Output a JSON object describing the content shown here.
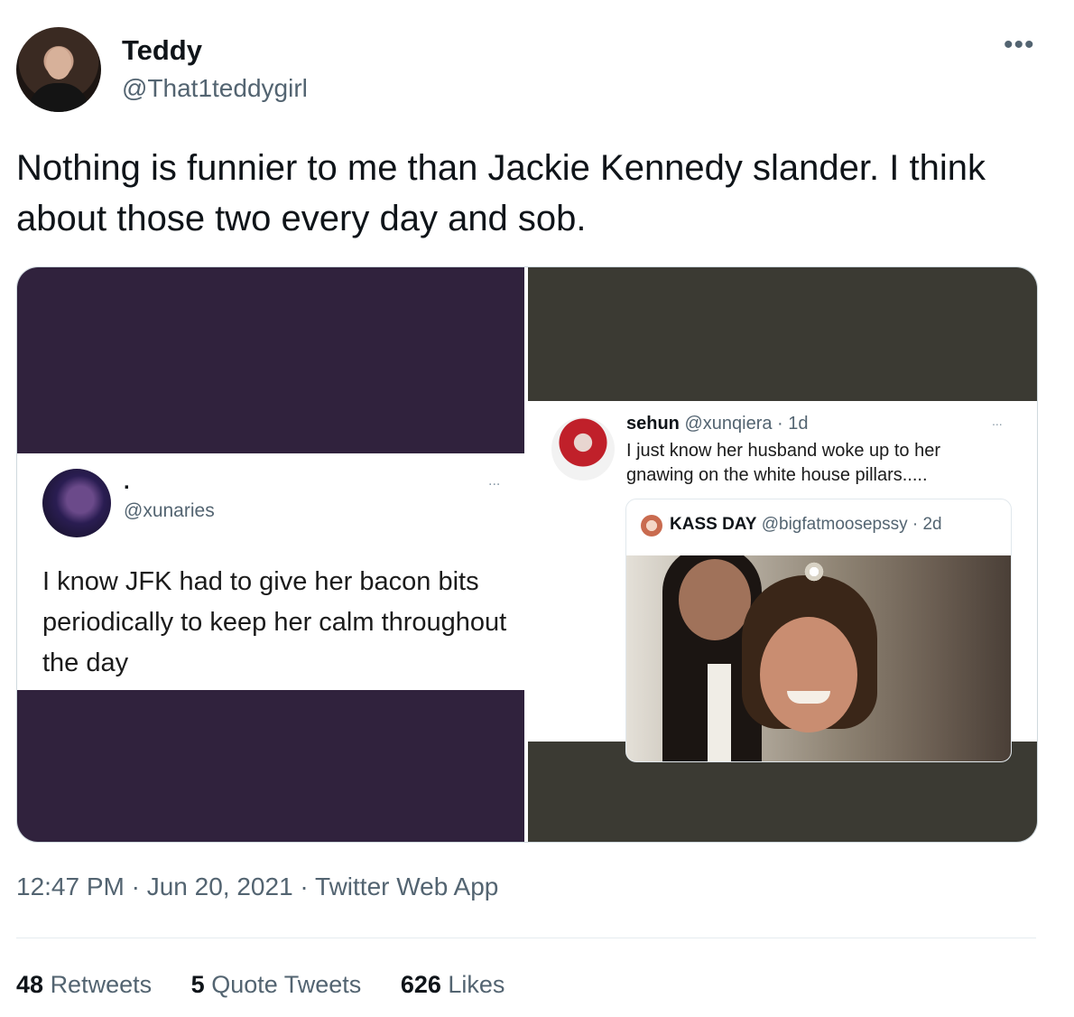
{
  "author": {
    "display_name": "Teddy",
    "handle": "@That1teddygirl"
  },
  "tweet": {
    "text": "Nothing is funnier to me than Jackie Kennedy slander. I think about those two every day and sob.",
    "more_icon": "more-horizontal-icon"
  },
  "media": {
    "left": {
      "name": ".",
      "handle": "@xunaries",
      "text": "I know JFK had to give her bacon bits periodically to keep her calm throughout the day",
      "more": "..."
    },
    "right": {
      "name": "sehun",
      "meta": "@xunqiera · 1d",
      "text": "I just know her husband woke up to her gnawing on the white house pillars.....",
      "more": "...",
      "quote": {
        "name": "KASS DAY",
        "meta": "@bigfatmoosepssy · 2d"
      }
    }
  },
  "meta": {
    "timestamp": "12:47 PM · Jun 20, 2021 · Twitter Web App"
  },
  "stats": {
    "retweets_count": "48",
    "retweets_label": "Retweets",
    "quotes_count": "5",
    "quotes_label": "Quote Tweets",
    "likes_count": "626",
    "likes_label": "Likes"
  },
  "colors": {
    "left_panel": "#30223d",
    "right_panel": "#3b3a33",
    "secondary_text": "#536471"
  }
}
